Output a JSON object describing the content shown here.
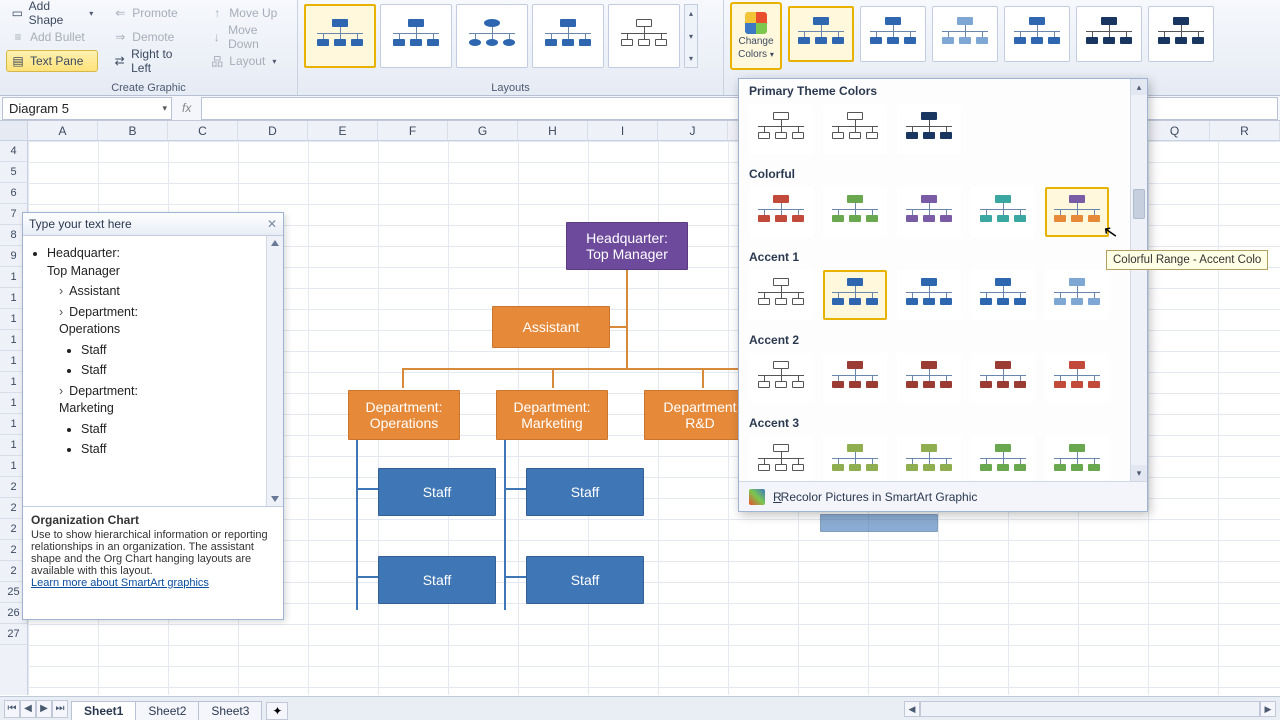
{
  "ribbon": {
    "create_graphic": {
      "label": "Create Graphic",
      "add_shape": "Add Shape",
      "add_bullet": "Add Bullet",
      "text_pane": "Text Pane",
      "promote": "Promote",
      "demote": "Demote",
      "rtl": "Right to Left",
      "move_up": "Move Up",
      "move_down": "Move Down",
      "layout": "Layout"
    },
    "layouts_label": "Layouts",
    "change_colors": {
      "line1": "Change",
      "line2": "Colors"
    }
  },
  "namebox": "Diagram 5",
  "columns": [
    "A",
    "B",
    "C",
    "D",
    "E",
    "F",
    "G",
    "H",
    "I",
    "J"
  ],
  "columns_right": [
    "Q",
    "R"
  ],
  "rows": [
    "4",
    "5",
    "6",
    "7",
    "8",
    "9",
    "1",
    "1",
    "1",
    "1",
    "1",
    "1",
    "1",
    "1",
    "1",
    "1",
    "2",
    "2",
    "2",
    "2",
    "2",
    "25",
    "26",
    "27"
  ],
  "textpane": {
    "title": "Type your text here",
    "items": {
      "root": "Headquarter:\nTop Manager",
      "assistant": "Assistant",
      "dept1": "Department:\nOperations",
      "dept1_children": [
        "Staff",
        "Staff"
      ],
      "dept2": "Department:\nMarketing",
      "dept2_children": [
        "Staff",
        "Staff"
      ]
    },
    "info_title": "Organization Chart",
    "info_body": "Use to show hierarchical information or reporting relationships in an organization. The assistant shape and the Org Chart hanging layouts are available with this layout.",
    "info_link": "Learn more about SmartArt graphics"
  },
  "diagram": {
    "root": "Headquarter:\nTop Manager",
    "assistant": "Assistant",
    "dept1": "Department:\nOperations",
    "dept2": "Department:\nMarketing",
    "dept3": "Department\nR&D",
    "staff": [
      "Staff",
      "Staff",
      "Staff",
      "Staff"
    ]
  },
  "color_panel": {
    "sec1": "Primary Theme Colors",
    "sec2": "Colorful",
    "sec3": "Accent 1",
    "sec4": "Accent 2",
    "sec5": "Accent 3",
    "footer": "Recolor Pictures in SmartArt Graphic"
  },
  "tooltip": "Colorful Range - Accent Colo",
  "sheet_tabs": [
    "Sheet1",
    "Sheet2",
    "Sheet3"
  ]
}
